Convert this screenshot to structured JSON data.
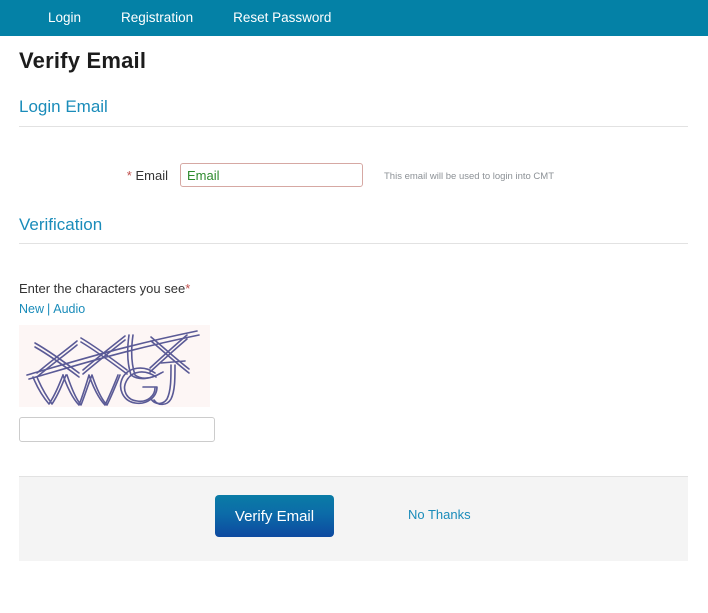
{
  "navbar": {
    "items": [
      {
        "label": "Login",
        "name": "nav-link-login"
      },
      {
        "label": "Registration",
        "name": "nav-link-registration"
      },
      {
        "label": "Reset Password",
        "name": "nav-link-reset-password"
      }
    ],
    "background_color": "#0481a6"
  },
  "page": {
    "title": "Verify Email"
  },
  "sections": {
    "login_email": {
      "heading": "Login Email",
      "email_field": {
        "label": "Email",
        "required_marker": "*",
        "value": "",
        "placeholder": "Email",
        "hint": "This email will be used to login into CMT",
        "border_color": "#d6a8a3",
        "text_color": "#2e8b2e"
      }
    },
    "verification": {
      "heading": "Verification",
      "prompt": "Enter the characters you see",
      "prompt_required_marker": "*",
      "links": [
        {
          "label": "New",
          "name": "captcha-new-link"
        },
        {
          "label": "Audio",
          "name": "captcha-audio-link"
        }
      ],
      "link_separator": "|",
      "captcha": {
        "characters": "XXLX VWGJ",
        "line_1": "XXLX",
        "line_2": "VWGJ",
        "stroke_color": "#5a5a96",
        "background_color": "#fdf6f5"
      },
      "captcha_input": {
        "value": "",
        "placeholder": ""
      }
    }
  },
  "footer": {
    "verify_button_label": "Verify Email",
    "no_thanks_label": "No Thanks",
    "panel_color": "#f4f4f4",
    "button_color": "#0d49a0",
    "link_color": "#1a8cba"
  }
}
